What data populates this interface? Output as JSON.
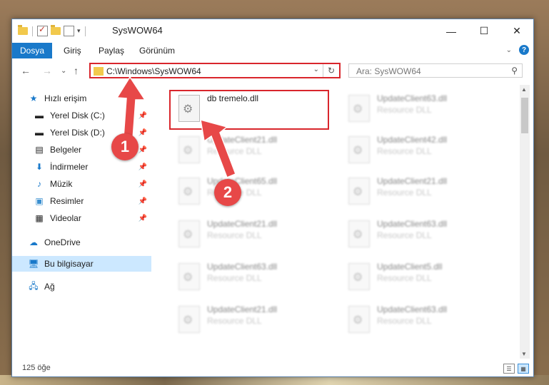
{
  "window": {
    "title": "SysWOW64",
    "minimize_glyph": "—",
    "maximize_glyph": "☐",
    "close_glyph": "✕"
  },
  "ribbon": {
    "file_tab": "Dosya",
    "tabs": [
      "Giriş",
      "Paylaş",
      "Görünüm"
    ],
    "help_glyph": "?"
  },
  "address": {
    "path": "C:\\Windows\\SysWOW64"
  },
  "search": {
    "placeholder": "Ara: SysWOW64"
  },
  "nav": {
    "quick_access": "Hızlı erişim",
    "items": [
      {
        "label": "Yerel Disk (C:)",
        "icon": "drive-icon"
      },
      {
        "label": "Yerel Disk (D:)",
        "icon": "drive-icon"
      },
      {
        "label": "Belgeler",
        "icon": "documents-icon"
      },
      {
        "label": "İndirmeler",
        "icon": "download-icon"
      },
      {
        "label": "Müzik",
        "icon": "music-icon"
      },
      {
        "label": "Resimler",
        "icon": "pictures-icon"
      },
      {
        "label": "Videolar",
        "icon": "videos-icon"
      }
    ],
    "onedrive": "OneDrive",
    "this_pc": "Bu bilgisayar",
    "network": "Ağ"
  },
  "files": {
    "focused": {
      "name": "db tremelo.dll"
    },
    "left_column": [
      {
        "name": "UpdateClient21.dll",
        "type": "Resource DLL"
      },
      {
        "name": "UpdateClient65.dll",
        "type": "Resource DLL"
      },
      {
        "name": "UpdateClient21.dll",
        "type": "Resource DLL"
      },
      {
        "name": "UpdateClient63.dll",
        "type": "Resource DLL"
      },
      {
        "name": "UpdateClient21.dll",
        "type": "Resource DLL"
      }
    ],
    "right_column": [
      {
        "name": "UpdateClient63.dll",
        "type": "Resource DLL"
      },
      {
        "name": "UpdateClient42.dll",
        "type": "Resource DLL"
      },
      {
        "name": "UpdateClient21.dll",
        "type": "Resource DLL"
      },
      {
        "name": "UpdateClient63.dll",
        "type": "Resource DLL"
      },
      {
        "name": "UpdateClient5.dll",
        "type": "Resource DLL"
      },
      {
        "name": "UpdateClient63.dll",
        "type": "Resource DLL"
      }
    ]
  },
  "status": {
    "count": "125 öğe"
  },
  "annotations": {
    "step1": "1",
    "step2": "2",
    "color": "#e74848"
  }
}
